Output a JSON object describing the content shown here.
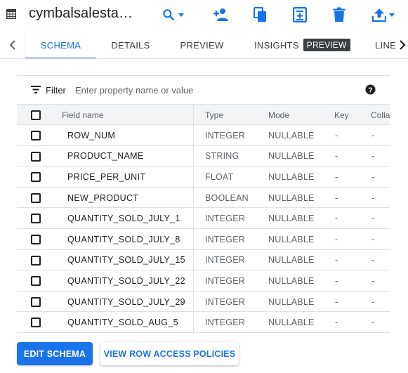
{
  "header": {
    "title": "cymbalsalesta…",
    "actions": [
      {
        "name": "search-dropdown",
        "icon": "search-icon"
      },
      {
        "name": "share",
        "icon": "person-add-icon"
      },
      {
        "name": "copy",
        "icon": "copy-icon"
      },
      {
        "name": "snapshot",
        "icon": "snapshot-icon"
      },
      {
        "name": "delete",
        "icon": "trash-icon"
      },
      {
        "name": "export",
        "icon": "upload-icon"
      }
    ],
    "accent_color": "#1a73e8"
  },
  "tabs": {
    "items": [
      {
        "label": "SCHEMA",
        "active": true
      },
      {
        "label": "DETAILS",
        "active": false
      },
      {
        "label": "PREVIEW",
        "active": false
      },
      {
        "label": "INSIGHTS",
        "active": false,
        "badge": "PREVIEW"
      },
      {
        "label": "LINE",
        "active": false
      }
    ]
  },
  "filter": {
    "label": "Filter",
    "placeholder": "Enter property name or value"
  },
  "table": {
    "columns": [
      "Field name",
      "Type",
      "Mode",
      "Key",
      "Colla"
    ],
    "rows": [
      {
        "field": "ROW_NUM",
        "type": "INTEGER",
        "mode": "NULLABLE",
        "key": "-",
        "collation": "-"
      },
      {
        "field": "PRODUCT_NAME",
        "type": "STRING",
        "mode": "NULLABLE",
        "key": "-",
        "collation": "-"
      },
      {
        "field": "PRICE_PER_UNIT",
        "type": "FLOAT",
        "mode": "NULLABLE",
        "key": "-",
        "collation": "-"
      },
      {
        "field": "NEW_PRODUCT",
        "type": "BOOLEAN",
        "mode": "NULLABLE",
        "key": "-",
        "collation": "-"
      },
      {
        "field": "QUANTITY_SOLD_JULY_1",
        "type": "INTEGER",
        "mode": "NULLABLE",
        "key": "-",
        "collation": "-"
      },
      {
        "field": "QUANTITY_SOLD_JULY_8",
        "type": "INTEGER",
        "mode": "NULLABLE",
        "key": "-",
        "collation": "-"
      },
      {
        "field": "QUANTITY_SOLD_JULY_15",
        "type": "INTEGER",
        "mode": "NULLABLE",
        "key": "-",
        "collation": "-"
      },
      {
        "field": "QUANTITY_SOLD_JULY_22",
        "type": "INTEGER",
        "mode": "NULLABLE",
        "key": "-",
        "collation": "-"
      },
      {
        "field": "QUANTITY_SOLD_JULY_29",
        "type": "INTEGER",
        "mode": "NULLABLE",
        "key": "-",
        "collation": "-"
      },
      {
        "field": "QUANTITY_SOLD_AUG_5",
        "type": "INTEGER",
        "mode": "NULLABLE",
        "key": "-",
        "collation": "-"
      }
    ]
  },
  "footer": {
    "edit_schema_label": "EDIT SCHEMA",
    "view_policies_label": "VIEW ROW ACCESS POLICIES"
  }
}
